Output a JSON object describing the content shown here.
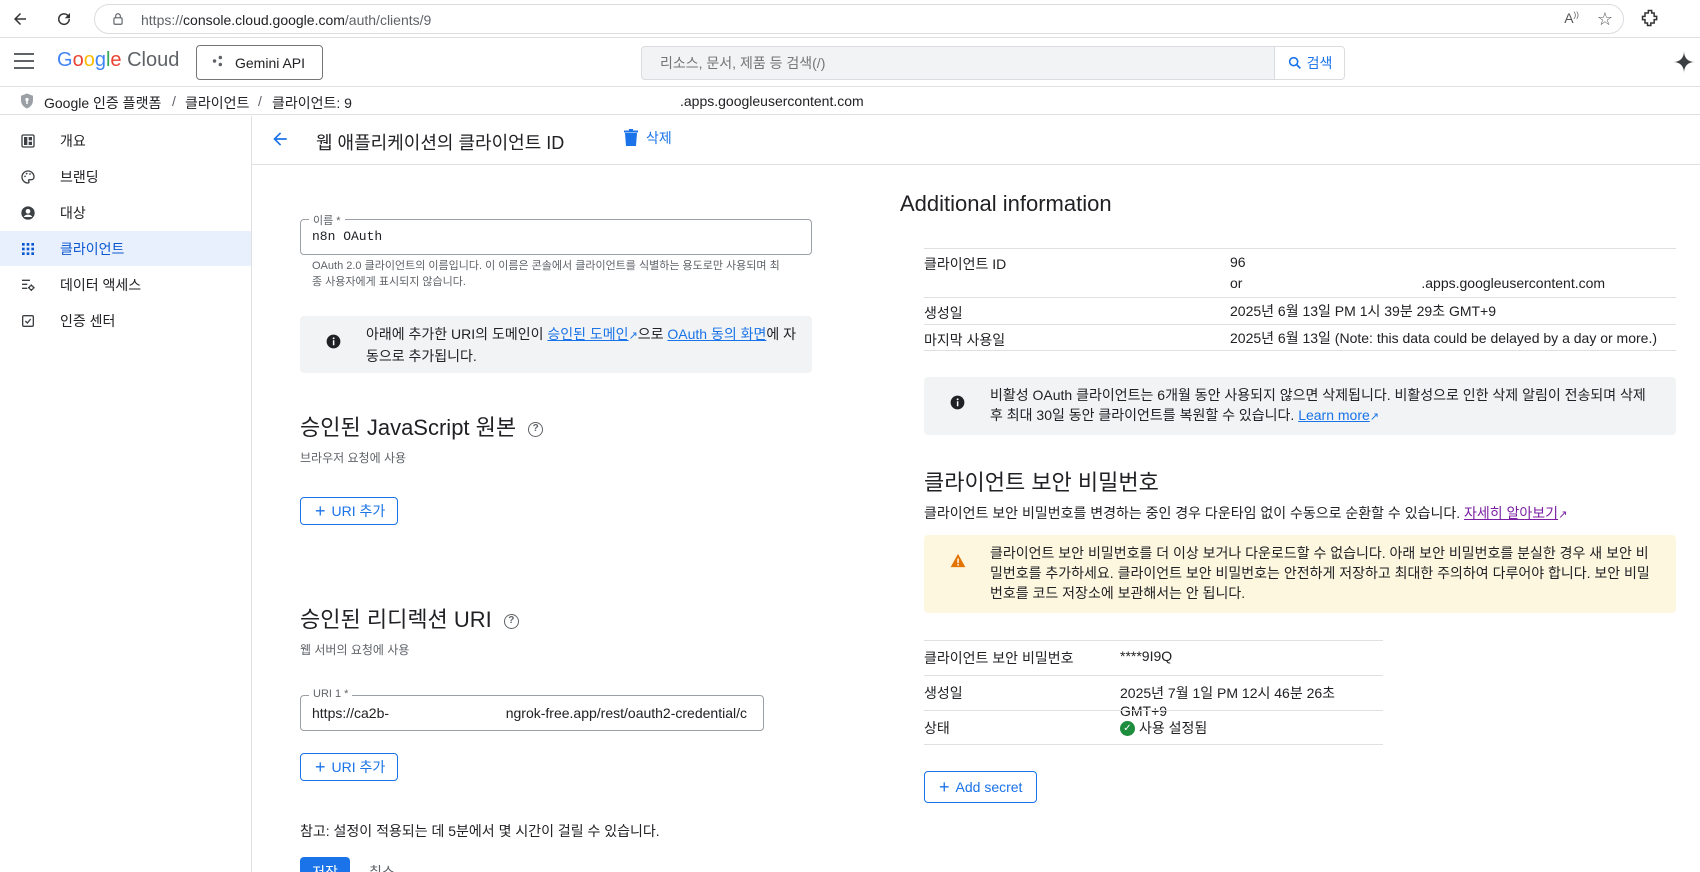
{
  "browser": {
    "url_prefix": "https://",
    "url_host": "console.cloud.google.com",
    "url_path": "/auth/clients/9"
  },
  "header": {
    "logo_text": "Google Cloud",
    "project_label": "Gemini API",
    "search_placeholder": "리소스, 문서, 제품 등 검색(/)",
    "search_button": "검색"
  },
  "breadcrumb": {
    "root": "Google 인증 플랫폼",
    "sep": "/",
    "clients": "클라이언트",
    "current": "클라이언트: 9",
    "suffix": ".apps.googleusercontent.com"
  },
  "sidebar": {
    "items": [
      {
        "label": "개요",
        "icon": "dashboard-icon"
      },
      {
        "label": "브랜딩",
        "icon": "palette-icon"
      },
      {
        "label": "대상",
        "icon": "person-icon"
      },
      {
        "label": "클라이언트",
        "icon": "apps-grid-icon",
        "active": true
      },
      {
        "label": "데이터 액세스",
        "icon": "data-settings-icon"
      },
      {
        "label": "인증 센터",
        "icon": "verified-icon"
      }
    ]
  },
  "page": {
    "title": "웹 애플리케이션의 클라이언트 ID",
    "delete_label": "삭제"
  },
  "form": {
    "name_label": "이름 *",
    "name_value": "n8n OAuth",
    "name_helper": "OAuth 2.0 클라이언트의 이름입니다. 이 이름은 콘솔에서 클라이언트를 식별하는 용도로만 사용되며 최종 사용자에게 표시되지 않습니다.",
    "domain_info_pre": "아래에 추가한 URI의 도메인이 ",
    "domain_info_link1": "승인된 도메인",
    "domain_info_mid": "으로 ",
    "domain_info_link2": "OAuth 동의 화면",
    "domain_info_post": "에 자동으로 추가됩니다.",
    "js_origins_title": "승인된 JavaScript 원본",
    "js_origins_sub": "브라우저 요청에 사용",
    "add_uri_label": "URI 추가",
    "redirect_title": "승인된 리디렉션 URI",
    "redirect_sub": "웹 서버의 요청에 사용",
    "uri1_label": "URI 1 *",
    "uri1_value": "https://ca2b-                              ngrok-free.app/rest/oauth2-credential/c",
    "note": "참고: 설정이 적용되는 데 5분에서 몇 시간이 걸릴 수 있습니다.",
    "save_label": "저장",
    "cancel_label": "취소"
  },
  "additional": {
    "title": "Additional information",
    "rows": [
      {
        "key": "클라이언트 ID",
        "value_line1": "96",
        "value_line2": "or                                              .apps.googleusercontent.com"
      },
      {
        "key": "생성일",
        "value": "2025년 6월 13일 PM 1시 39분 29초 GMT+9"
      },
      {
        "key": "마지막 사용일",
        "value": "2025년 6월 13일 (Note: this data could be delayed by a day or more.)"
      }
    ],
    "inactive_info": "비활성 OAuth 클라이언트는 6개월 동안 사용되지 않으면 삭제됩니다. 비활성으로 인한 삭제 알림이 전송되며 삭제 후 최대 30일 동안 클라이언트를 복원할 수 있습니다.",
    "learn_more": "Learn more"
  },
  "secret": {
    "title": "클라이언트 보안 비밀번호",
    "desc": "클라이언트 보안 비밀번호를 변경하는 중인 경우 다운타임 없이 수동으로 순환할 수 있습니다.",
    "desc_link": "자세히 알아보기",
    "warning": "클라이언트 보안 비밀번호를 더 이상 보거나 다운로드할 수 없습니다. 아래 보안 비밀번호를 분실한 경우 새 보안 비밀번호를 추가하세요. 클라이언트 보안 비밀번호는 안전하게 저장하고 최대한 주의하여 다루어야 합니다. 보안 비밀번호를 코드 저장소에 보관해서는 안 됩니다.",
    "rows": [
      {
        "key": "클라이언트 보안 비밀번호",
        "value": "****9I9Q"
      },
      {
        "key": "생성일",
        "value": "2025년 7월 1일 PM 12시 46분 26초 GMT+9"
      },
      {
        "key": "상태",
        "value": "사용 설정됨"
      }
    ],
    "add_secret": "Add secret"
  }
}
